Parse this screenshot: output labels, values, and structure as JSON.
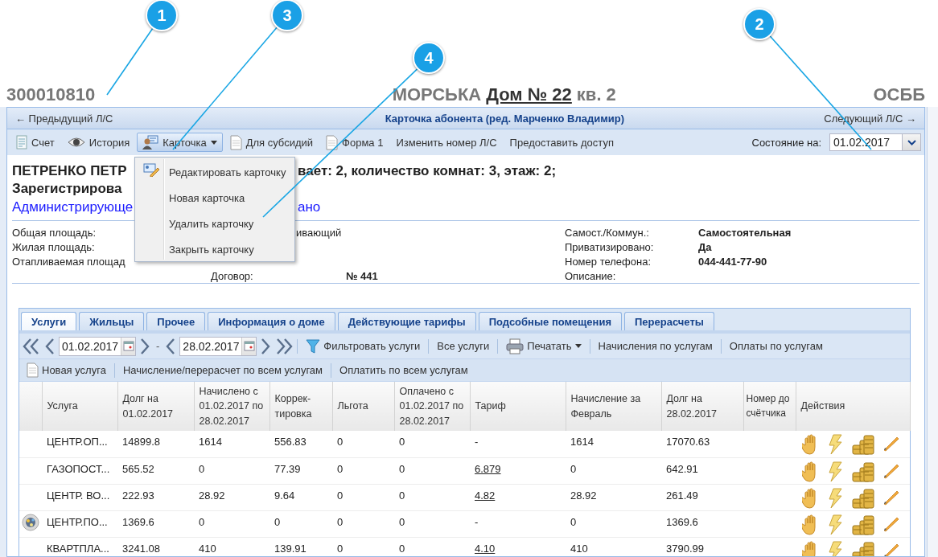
{
  "callouts": [
    {
      "number": "1"
    },
    {
      "number": "3"
    },
    {
      "number": "4"
    },
    {
      "number": "2"
    }
  ],
  "header": {
    "account": "300010810",
    "street": "МОРСЬКА",
    "house": "Дом № 22",
    "flat": "кв. 2",
    "org": "ОСББ"
  },
  "panel": {
    "prev": "← Предыдущий Л/С",
    "title": "Карточка абонента (ред. Марченко Владимир)",
    "next": "Следующий Л/С →"
  },
  "toolbar": {
    "buttons": [
      {
        "label": "Счет",
        "pressed": false,
        "dropdown": false
      },
      {
        "label": "История",
        "pressed": false,
        "dropdown": false
      },
      {
        "label": "Карточка",
        "pressed": true,
        "dropdown": true
      },
      {
        "label": "Для субсидий",
        "pressed": false,
        "dropdown": false
      },
      {
        "label": "Форма 1",
        "pressed": false,
        "dropdown": false
      },
      {
        "label": "Изменить номер Л/С",
        "pressed": false,
        "dropdown": false
      },
      {
        "label": "Предоставить доступ",
        "pressed": false,
        "dropdown": false
      }
    ],
    "state_label": "Состояние на:",
    "state_date": "01.02.2017"
  },
  "card_menu": [
    {
      "label": "Редактировать карточку"
    },
    {
      "label": "Новая карточка"
    },
    {
      "label": "Удалить карточку"
    },
    {
      "label": "Закрыть карточку"
    }
  ],
  "summary": [
    {
      "kind": "title",
      "left": "ПЕТРЕНКО ПЕТР",
      "right": "вает: 2, количество комнат: 3, этаж: 2;"
    },
    {
      "kind": "title",
      "left": "Зарегистрирова"
    },
    {
      "kind": "link",
      "left": "Администрирующе",
      "right": "ано"
    }
  ],
  "details": [
    {
      "left_label": "Общая площадь:",
      "mid_fragment": "ивающий",
      "right_label": "Самост./Коммун.:",
      "right_value": "Самостоятельная"
    },
    {
      "left_label": "Жилая площадь:",
      "right_label": "Приватизировано:",
      "right_value": "Да"
    },
    {
      "left_label": "Отапливаемая площад",
      "right_label": "Номер телефона:",
      "right_value": "044-441-77-90"
    },
    {
      "mid_label": "Договор:",
      "mid_value": "№ 441",
      "right_label": "Описание:"
    }
  ],
  "services": {
    "tabs": [
      {
        "label": "Услуги",
        "selected": true
      },
      {
        "label": "Жильцы",
        "selected": false
      },
      {
        "label": "Прочее",
        "selected": false
      },
      {
        "label": "Информация о доме",
        "selected": false
      },
      {
        "label": "Действующие тарифы",
        "selected": false
      },
      {
        "label": "Подсобные помещения",
        "selected": false
      },
      {
        "label": "Перерасчеты",
        "selected": false
      }
    ],
    "date_from": "01.02.2017",
    "date_separator": "-",
    "date_to": "28.02.2017",
    "tools": [
      {
        "label": "Фильтровать услуги",
        "dropdown": false
      },
      {
        "label": "Все услуги",
        "dropdown": false
      },
      {
        "label": "Печатать",
        "dropdown": true
      },
      {
        "label": "Начисления по услугам",
        "dropdown": false
      },
      {
        "label": "Оплаты по услугам",
        "dropdown": false
      }
    ],
    "actions": [
      {
        "label": "Новая услуга"
      },
      {
        "label": "Начисление/перерасчет по всем услугам"
      },
      {
        "label": "Оплатить по всем услугам"
      }
    ],
    "table": {
      "columns": [
        "Услуга",
        "Долг на 01.02.2017",
        "Начислено с 01.02.2017 по 28.02.2017",
        "Коррек-тировка",
        "Льгота",
        "Оплачено с 01.02.2017 по 28.02.2017",
        "Тариф",
        "Начисление за Февраль",
        "Долг на 28.02.2017",
        "Номер до счётчика",
        "Действия"
      ],
      "rows": [
        {
          "status_icon": false,
          "service": "ЦЕНТР.ОП...",
          "debt_start": "14899.8",
          "accrued": "1614",
          "correction": "556.83",
          "benefit": "0",
          "paid": "0",
          "tariff": "-",
          "tariff_link": false,
          "accrued_month": "1614",
          "debt_end": "17070.63"
        },
        {
          "status_icon": false,
          "service": "ГАЗОПОСТ...",
          "debt_start": "565.52",
          "accrued": "0",
          "correction": "77.39",
          "benefit": "0",
          "paid": "0",
          "tariff": "6.879",
          "tariff_link": true,
          "accrued_month": "0",
          "debt_end": "642.91"
        },
        {
          "status_icon": false,
          "service": "ЦЕНТР. ВО...",
          "debt_start": "222.93",
          "accrued": "28.92",
          "correction": "9.64",
          "benefit": "0",
          "paid": "0",
          "tariff": "4.82",
          "tariff_link": true,
          "accrued_month": "28.92",
          "debt_end": "261.49"
        },
        {
          "status_icon": true,
          "service": "ЦЕНТР.ПО...",
          "debt_start": "1369.6",
          "accrued": "0",
          "correction": "0",
          "benefit": "0",
          "paid": "0",
          "tariff": "-",
          "tariff_link": false,
          "accrued_month": "0",
          "debt_end": "1369.6"
        },
        {
          "status_icon": false,
          "service": "КВАРТПЛА...",
          "debt_start": "3241.08",
          "accrued": "410",
          "correction": "139.91",
          "benefit": "0",
          "paid": "0",
          "tariff": "4.10",
          "tariff_link": true,
          "accrued_month": "410",
          "debt_end": "3790.99"
        }
      ]
    }
  }
}
